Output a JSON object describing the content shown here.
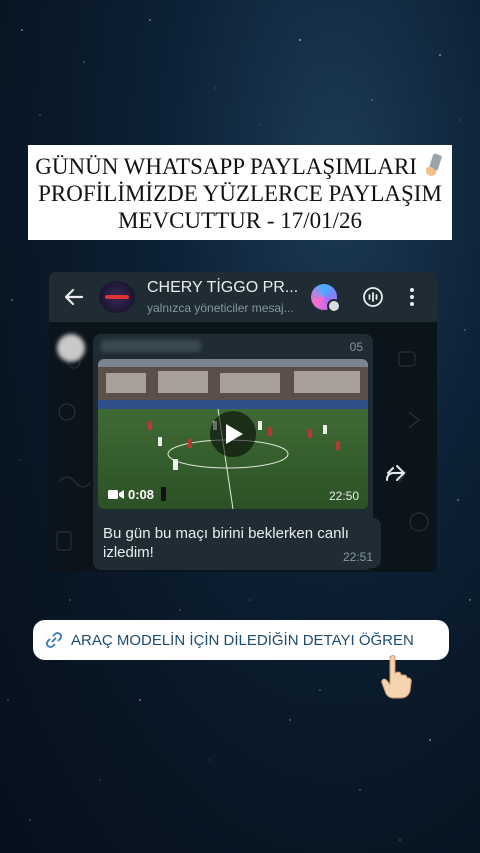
{
  "banner": {
    "line1": "GÜNÜN WHATSAPP PAYLAŞIMLARI",
    "line2": "PROFİLİMİZDE YÜZLERCE PAYLAŞIM",
    "line3": "MEVCUTTUR  - 17/01/26",
    "emoji_icon": "mobile-phone-hand-icon"
  },
  "chat": {
    "title": "CHERY TİGGO PR...",
    "subtitle": "yalnızca yöneticiler mesaj...",
    "message": {
      "header_time": "05",
      "video_duration": "0:08",
      "video_time": "22:50",
      "caption": "Bu gün bu maçı birini beklerken canlı izledim!",
      "caption_time": "22:51"
    }
  },
  "link_sticker": {
    "label": "ARAÇ MODELİN İÇİN DİLEDİĞİN DETAYI ÖĞREN"
  },
  "colors": {
    "header_bg": "#1f2c33",
    "chat_bg": "#0b141a",
    "bubble_bg": "#1f2c33",
    "link_text": "#1d4b6f"
  }
}
